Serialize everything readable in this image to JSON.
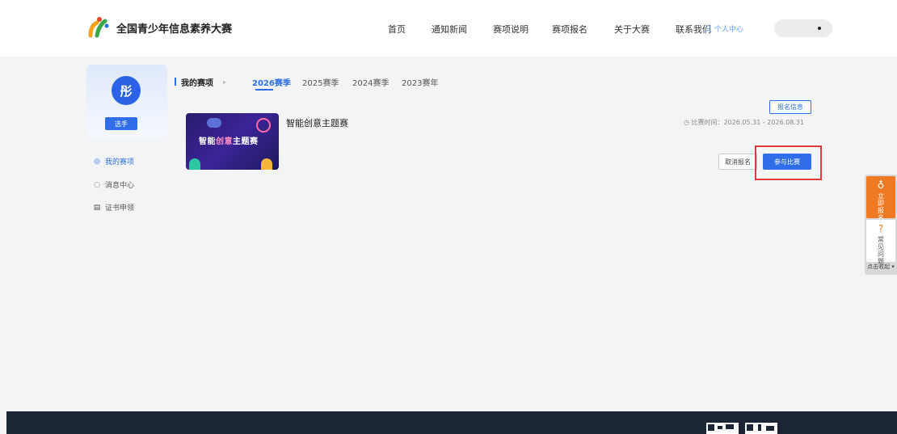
{
  "header": {
    "logo_text": "全国青少年信息素养大赛",
    "nav": [
      {
        "label": "首页"
      },
      {
        "label": "通知新闻"
      },
      {
        "label": "赛项说明"
      },
      {
        "label": "赛项报名"
      },
      {
        "label": "关于大赛"
      },
      {
        "label": "联系我们"
      }
    ],
    "user_center": "个人中心"
  },
  "sidebar": {
    "avatar_char": "彤",
    "role": "选手",
    "items": [
      {
        "label": "我的赛项",
        "icon": "target-icon"
      },
      {
        "label": "消息中心",
        "icon": "bell-icon"
      },
      {
        "label": "证书申领",
        "icon": "certificate-icon"
      }
    ]
  },
  "main": {
    "title": "我的赛项",
    "seasons": [
      {
        "label": "2026赛季"
      },
      {
        "label": "2025赛季"
      },
      {
        "label": "2024赛季"
      },
      {
        "label": "2023赛年"
      }
    ],
    "competition": {
      "thumb_title_a": "智能",
      "thumb_title_b": "创意",
      "thumb_title_c": "主题赛",
      "name": "智能创意主题赛",
      "info_button": "报名信息",
      "time": "比赛时间：2026.05.31 - 2026.08.31",
      "cancel_button": "取消报名",
      "join_button": "参与比赛"
    }
  },
  "float": {
    "apply": "立即报名",
    "faq": "常见问题",
    "collapse": "点击收起"
  },
  "colors": {
    "primary": "#2f6ee8",
    "accent": "#f07a24",
    "highlight": "#e03b3b",
    "footer": "#1b2536"
  }
}
